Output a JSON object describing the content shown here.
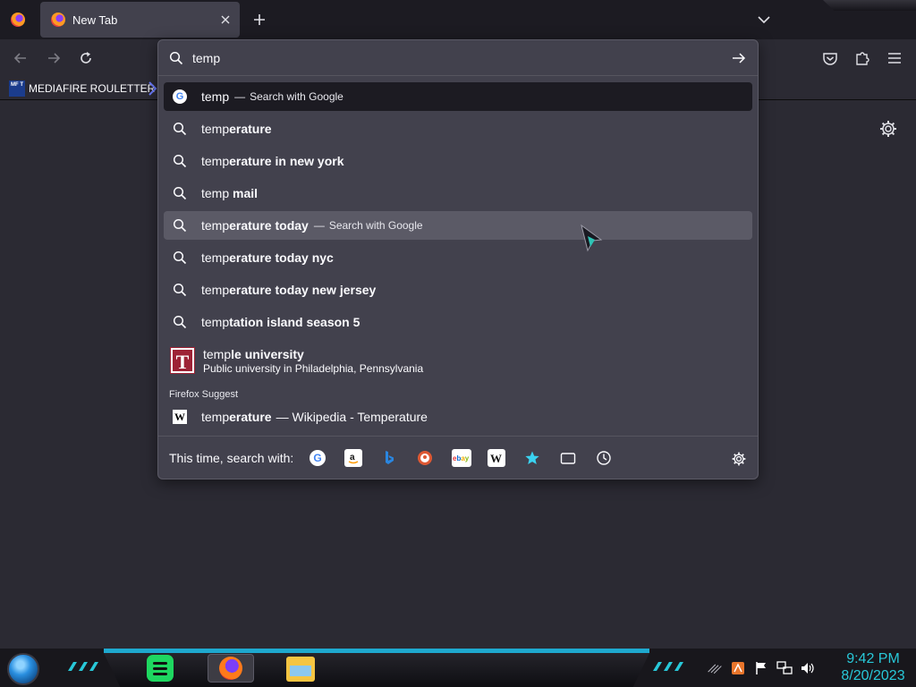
{
  "browser": {
    "tab": {
      "title": "New Tab"
    },
    "bookmarks": [
      {
        "label": "MEDIAFIRE ROULETTER",
        "icon_text": "MF T"
      }
    ]
  },
  "urlbar": {
    "value": "temp",
    "results": [
      {
        "typed": "temp",
        "completion": "",
        "action": "Search with Google",
        "icon": "google-icon",
        "state": "selected"
      },
      {
        "typed": "temp",
        "completion": "erature",
        "action": "",
        "icon": "search-icon",
        "state": ""
      },
      {
        "typed": "temp",
        "completion": "erature in new york",
        "action": "",
        "icon": "search-icon",
        "state": ""
      },
      {
        "typed": "temp",
        "completion": " mail",
        "action": "",
        "icon": "search-icon",
        "state": ""
      },
      {
        "typed": "temp",
        "completion": "erature today",
        "action": "Search with Google",
        "icon": "search-icon",
        "state": "hover"
      },
      {
        "typed": "temp",
        "completion": "erature today nyc",
        "action": "",
        "icon": "search-icon",
        "state": ""
      },
      {
        "typed": "temp",
        "completion": "erature today new jersey",
        "action": "",
        "icon": "search-icon",
        "state": ""
      },
      {
        "typed": "temp",
        "completion": "tation island season 5",
        "action": "",
        "icon": "search-icon",
        "state": ""
      }
    ],
    "temple": {
      "typed": "temp",
      "completion": "le university",
      "subtitle": "Public university in Philadelphia, Pennsylvania",
      "logo_letter": "T"
    },
    "group_label": "Firefox Suggest",
    "wiki": {
      "typed": "temp",
      "completion": "erature",
      "tail": "— Wikipedia - Temperature",
      "icon_letter": "W"
    },
    "action_dash": "—",
    "oneoff": {
      "label": "This time, search with:",
      "engines": [
        "google-icon",
        "amazon-icon",
        "bing-icon",
        "duckduckgo-icon",
        "ebay-icon",
        "wikipedia-icon",
        "bookmarks-star-icon",
        "tabs-icon",
        "history-icon"
      ]
    }
  },
  "taskbar": {
    "time": "9:42 PM",
    "date": "8/20/2023"
  },
  "colors": {
    "accent": "#28c8d8",
    "toolbar": "#2b2a33",
    "popup": "#42414d"
  }
}
